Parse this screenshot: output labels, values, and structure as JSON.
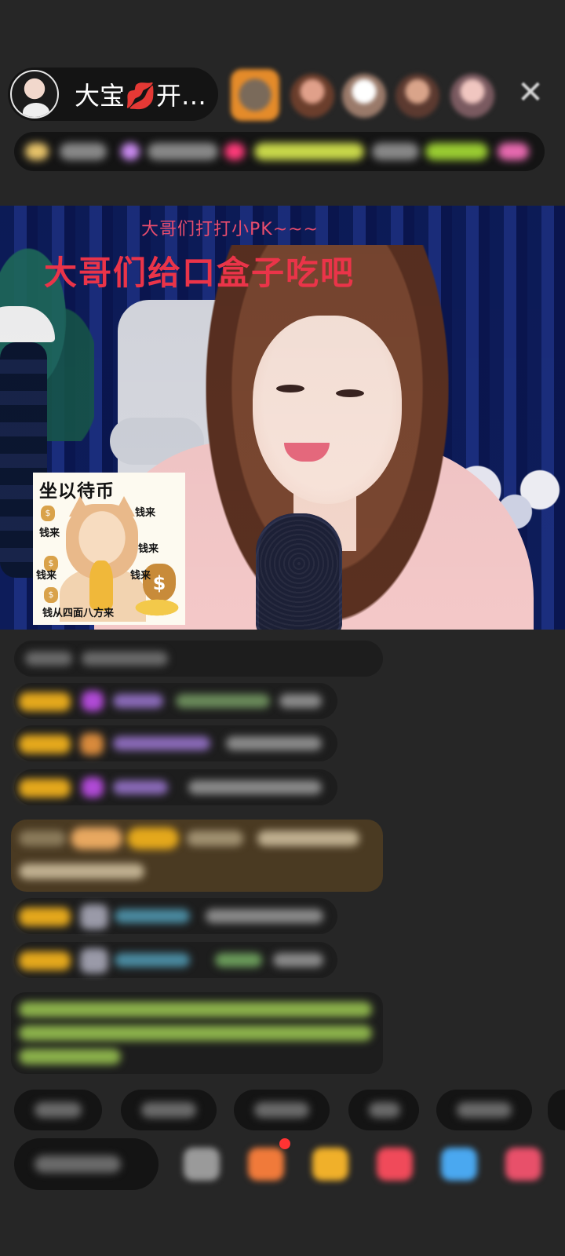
{
  "header": {
    "host_name": "大宝💋开…",
    "close_label": "✕"
  },
  "video": {
    "overlay_small": "大哥们打打小PK~~~",
    "overlay_big": "大哥们给口盒子吃吧"
  },
  "sticker": {
    "title": "坐以待币",
    "labels": [
      "钱来",
      "钱来",
      "钱来",
      "钱来",
      "钱来"
    ],
    "bag_symbol": "$",
    "bottom_text": "钱从四面八方来"
  },
  "colors": {
    "background": "#262626",
    "overlay_text": "#ea3449",
    "gift_row": "#4a3a22",
    "system_text": "#9acd32"
  }
}
